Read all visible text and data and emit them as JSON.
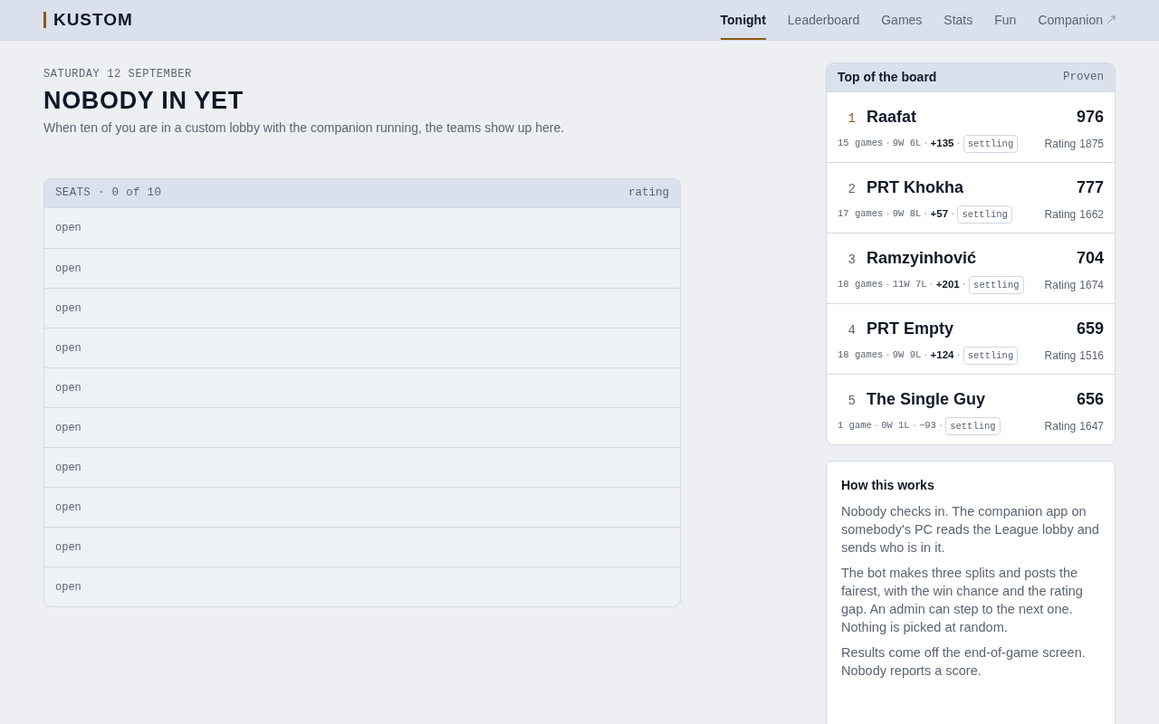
{
  "brand": "KUSTOM",
  "nav": [
    {
      "label": "Tonight",
      "selected": true,
      "external": false
    },
    {
      "label": "Leaderboard",
      "selected": false,
      "external": false
    },
    {
      "label": "Games",
      "selected": false,
      "external": false
    },
    {
      "label": "Stats",
      "selected": false,
      "external": false
    },
    {
      "label": "Fun",
      "selected": false,
      "external": false
    },
    {
      "label": "Companion",
      "selected": false,
      "external": true
    }
  ],
  "date": "SATURDAY 12 SEPTEMBER",
  "heading": "NOBODY IN YET",
  "subtitle": "When ten of you are in a custom lobby with the companion running, the teams show up here.",
  "seats": {
    "title": "SEATS · 0 of 10",
    "column": "rating",
    "rows": [
      "open",
      "open",
      "open",
      "open",
      "open",
      "open",
      "open",
      "open",
      "open",
      "open"
    ]
  },
  "board": {
    "title": "Top of the board",
    "tag": "Proven",
    "players": [
      {
        "rank": "1",
        "highlight": true,
        "name": "Raafat",
        "score": "976",
        "stats": [
          {
            "kind": "text",
            "text": "15 games"
          },
          {
            "kind": "sep",
            "text": "·"
          },
          {
            "kind": "text",
            "text": "9W 6L"
          },
          {
            "kind": "sep",
            "text": "·"
          },
          {
            "kind": "gain",
            "text": "+135"
          },
          {
            "kind": "sep",
            "text": "·"
          },
          {
            "kind": "tag",
            "text": "settling"
          }
        ],
        "rating_label": "Rating",
        "rating": "1875"
      },
      {
        "rank": "2",
        "highlight": false,
        "name": "PRT Khokha",
        "score": "777",
        "stats": [
          {
            "kind": "text",
            "text": "17 games"
          },
          {
            "kind": "sep",
            "text": "·"
          },
          {
            "kind": "text",
            "text": "9W 8L"
          },
          {
            "kind": "sep",
            "text": "·"
          },
          {
            "kind": "gain",
            "text": "+57"
          },
          {
            "kind": "sep",
            "text": "·"
          },
          {
            "kind": "tag",
            "text": "settling"
          }
        ],
        "rating_label": "Rating",
        "rating": "1662"
      },
      {
        "rank": "3",
        "highlight": false,
        "name": "Ramzyinhović",
        "score": "704",
        "stats": [
          {
            "kind": "text",
            "text": "18 games"
          },
          {
            "kind": "sep",
            "text": "·"
          },
          {
            "kind": "text",
            "text": "11W 7L"
          },
          {
            "kind": "sep",
            "text": "·"
          },
          {
            "kind": "gain",
            "text": "+201"
          },
          {
            "kind": "sep",
            "text": "·"
          },
          {
            "kind": "tag",
            "text": "settling"
          }
        ],
        "rating_label": "Rating",
        "rating": "1674"
      },
      {
        "rank": "4",
        "highlight": false,
        "name": "PRT Empty",
        "score": "659",
        "stats": [
          {
            "kind": "text",
            "text": "18 games"
          },
          {
            "kind": "sep",
            "text": "·"
          },
          {
            "kind": "text",
            "text": "9W 9L"
          },
          {
            "kind": "sep",
            "text": "·"
          },
          {
            "kind": "gain",
            "text": "+124"
          },
          {
            "kind": "sep",
            "text": "·"
          },
          {
            "kind": "tag",
            "text": "settling"
          }
        ],
        "rating_label": "Rating",
        "rating": "1516"
      },
      {
        "rank": "5",
        "highlight": false,
        "name": "The Single Guy",
        "score": "656",
        "stats": [
          {
            "kind": "text",
            "text": "1 game"
          },
          {
            "kind": "sep",
            "text": "·"
          },
          {
            "kind": "text",
            "text": "0W 1L"
          },
          {
            "kind": "sep",
            "text": "·"
          },
          {
            "kind": "loss",
            "text": "−93"
          },
          {
            "kind": "sep",
            "text": "·"
          },
          {
            "kind": "tag",
            "text": "settling"
          }
        ],
        "rating_label": "Rating",
        "rating": "1647"
      }
    ]
  },
  "how": {
    "title": "How this works",
    "paragraphs": [
      "Nobody checks in. The companion app on somebody's PC reads the League lobby and sends who is in it.",
      "The bot makes three splits and posts the fairest, with the win chance and the rating gap. An admin can step to the next one. Nothing is picked at random.",
      "Results come off the end-of-game screen. Nobody reports a score."
    ]
  }
}
